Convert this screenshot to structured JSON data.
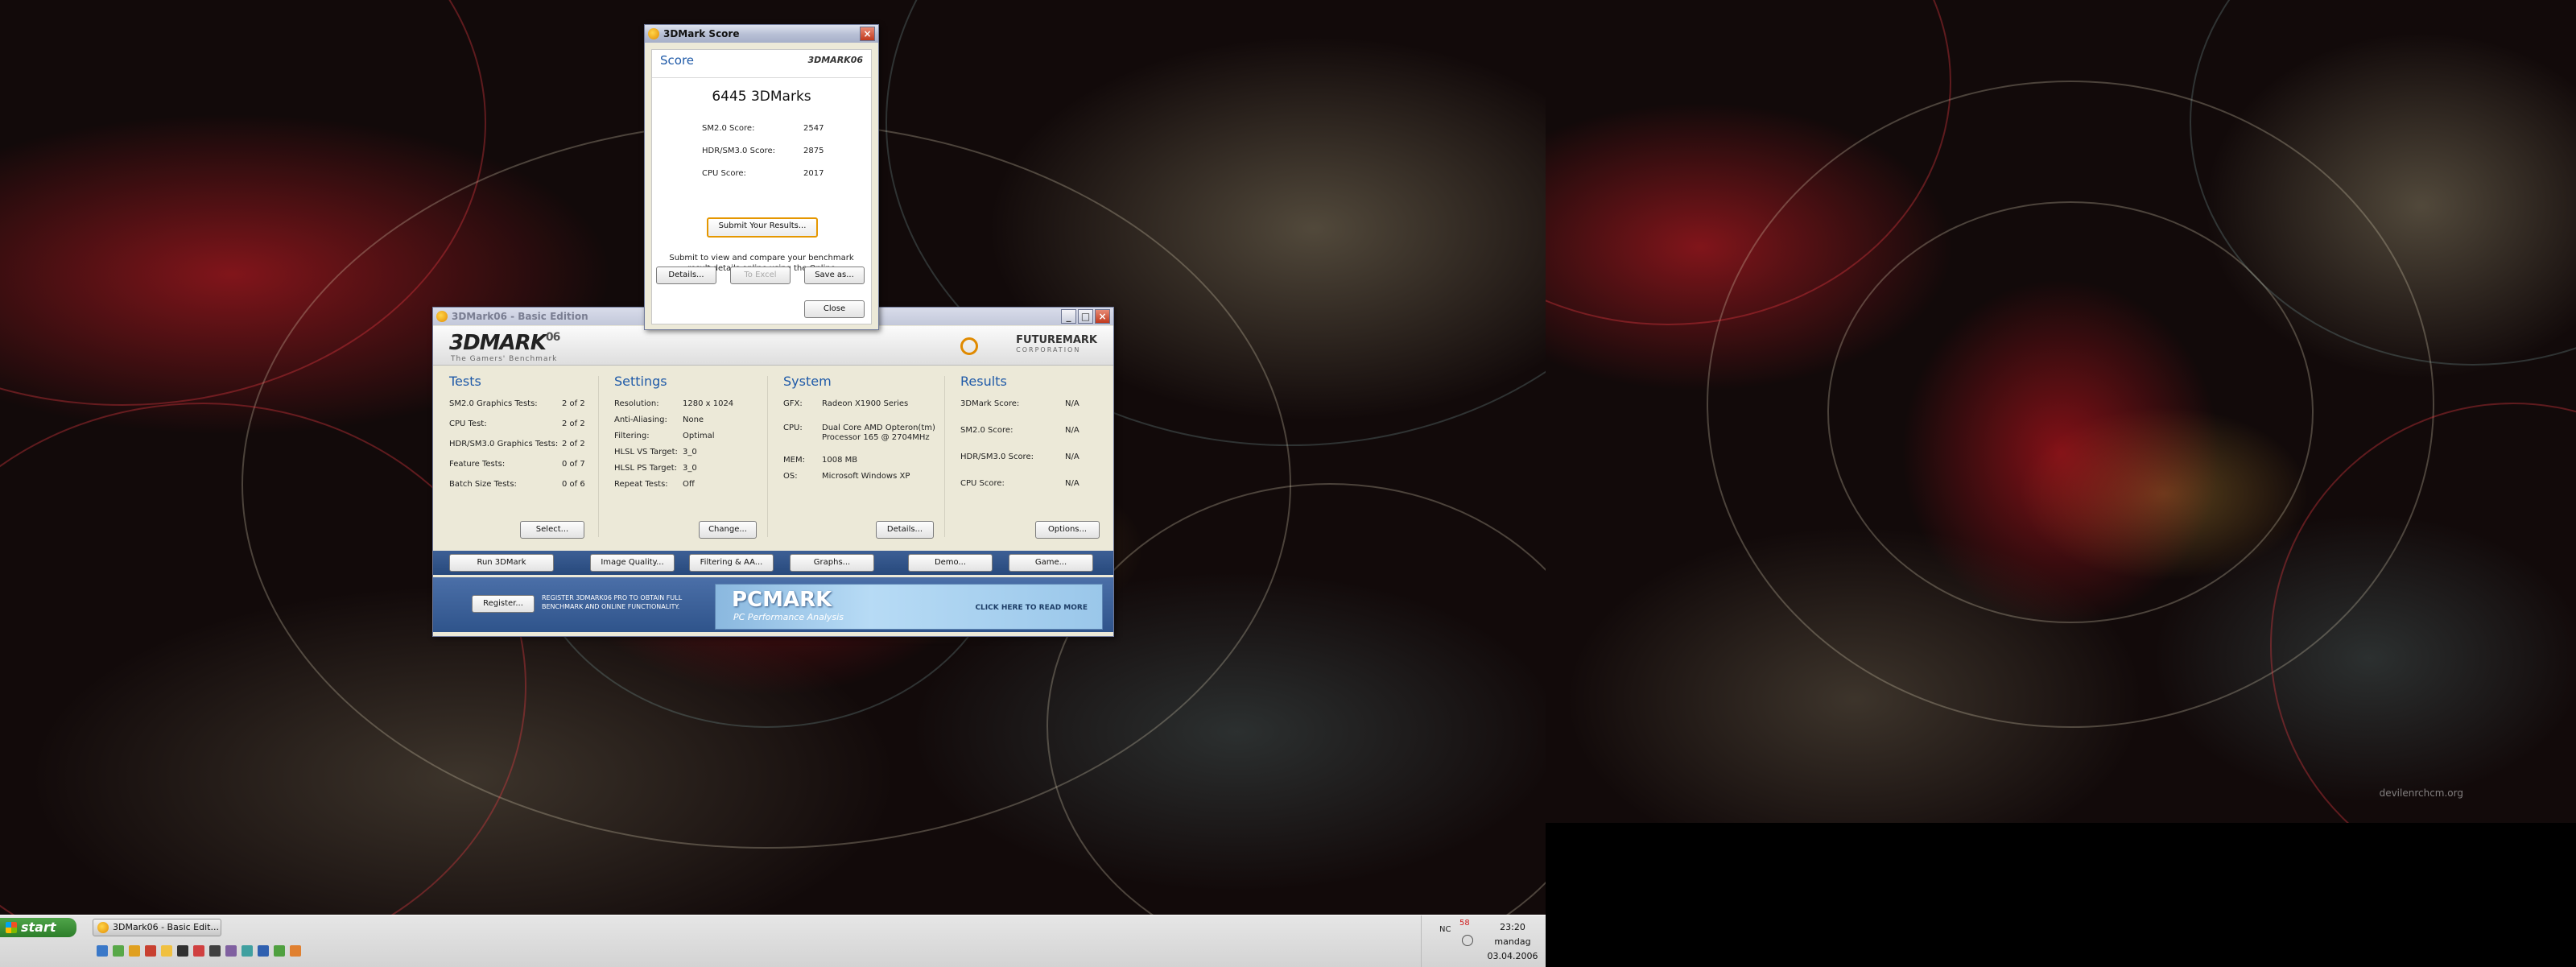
{
  "wallpaper": {
    "watermark": "devilenrchcm.org"
  },
  "score_dialog": {
    "title": "3DMark Score",
    "section_label": "Score",
    "brand": "3DMARK06",
    "total": "6445 3DMarks",
    "rows": [
      {
        "label": "SM2.0 Score:",
        "value": "2547"
      },
      {
        "label": "HDR/SM3.0 Score:",
        "value": "2875"
      },
      {
        "label": "CPU Score:",
        "value": "2017"
      }
    ],
    "submit_label": "Submit Your Results...",
    "info_text": "Submit to view and compare your benchmark result details online using the Online ResultBrowser",
    "details_label": "Details...",
    "to_excel_label": "To Excel",
    "save_label": "Save as...",
    "close_label": "Close"
  },
  "main_window": {
    "title": "3DMark06 - Basic Edition",
    "logo": "3DMARK",
    "logo_sup": "06",
    "tagline": "The Gamers' Benchmark",
    "futuremark": "FUTUREMARK",
    "futuremark_sub": "CORPORATION",
    "tests": {
      "title": "Tests",
      "rows": [
        {
          "label": "SM2.0 Graphics Tests:",
          "value": "2 of 2"
        },
        {
          "label": "CPU Test:",
          "value": "2 of 2"
        },
        {
          "label": "HDR/SM3.0 Graphics Tests:",
          "value": "2 of 2"
        },
        {
          "label": "Feature Tests:",
          "value": "0 of 7"
        },
        {
          "label": "Batch Size Tests:",
          "value": "0 of 6"
        }
      ],
      "button": "Select..."
    },
    "settings": {
      "title": "Settings",
      "rows": [
        {
          "label": "Resolution:",
          "value": "1280 x 1024"
        },
        {
          "label": "Anti-Aliasing:",
          "value": "None"
        },
        {
          "label": "Filtering:",
          "value": "Optimal"
        },
        {
          "label": "HLSL VS Target:",
          "value": "3_0"
        },
        {
          "label": "HLSL PS Target:",
          "value": "3_0"
        },
        {
          "label": "Repeat Tests:",
          "value": "Off"
        }
      ],
      "button": "Change..."
    },
    "system": {
      "title": "System",
      "gfx_label": "GFX:",
      "gfx_value": "Radeon X1900 Series",
      "cpu_label": "CPU:",
      "cpu_value1": "Dual Core AMD Opteron(tm)",
      "cpu_value2": "Processor 165 @ 2704MHz",
      "mem_label": "MEM:",
      "mem_value": "1008 MB",
      "os_label": "OS:",
      "os_value": "Microsoft Windows XP",
      "button": "Details..."
    },
    "results": {
      "title": "Results",
      "rows": [
        {
          "label": "3DMark Score:",
          "value": "N/A"
        },
        {
          "label": "SM2.0 Score:",
          "value": "N/A"
        },
        {
          "label": "HDR/SM3.0 Score:",
          "value": "N/A"
        },
        {
          "label": "CPU Score:",
          "value": "N/A"
        }
      ],
      "button": "Options..."
    },
    "toolbar": [
      "Run 3DMark",
      "Image Quality...",
      "Filtering & AA...",
      "Graphs...",
      "Demo...",
      "Game..."
    ],
    "register_label": "Register...",
    "register_text": "REGISTER 3DMARK06 PRO TO OBTAIN FULL BENCHMARK AND ONLINE FUNCTIONALITY.",
    "pcmark_title": "PCMARK",
    "pcmark_sub": "PC Performance Analysis",
    "pcmark_cta": "CLICK HERE TO READ MORE"
  },
  "taskbar": {
    "start_label": "start",
    "task_label": "3DMark06 - Basic Edit...",
    "tray_nc": "NC",
    "tray_temp": "58",
    "time": "23:20",
    "day": "mandag",
    "date": "03.04.2006"
  }
}
